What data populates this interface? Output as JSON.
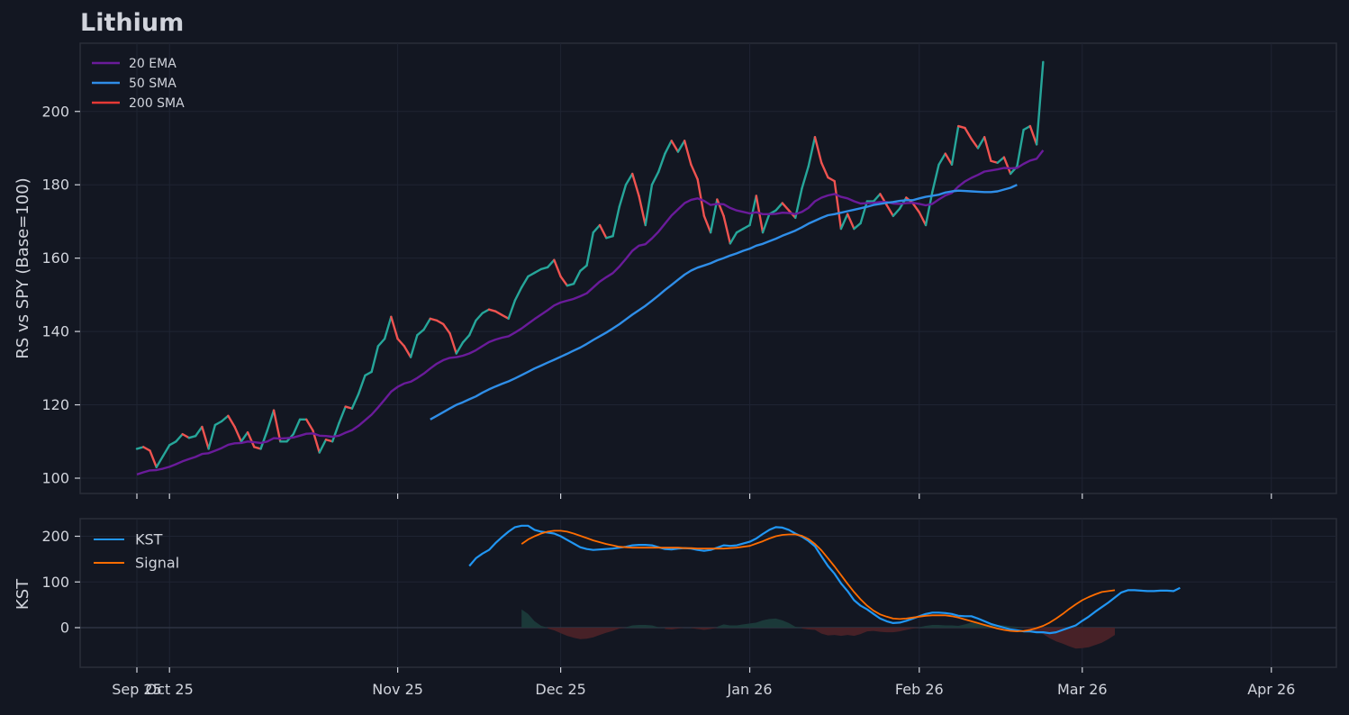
{
  "title": "Lithium",
  "colors": {
    "background": "#131722",
    "grid": "#1f2433",
    "axis_text": "#d1d4dc",
    "rs_up": "#26a69a",
    "rs_down": "#ef5350",
    "ema20": "#6a1b9a",
    "sma50": "#2f8ee8",
    "sma200": "#e53935",
    "kst": "#2196f3",
    "signal": "#ff6d00",
    "hist_pos": "#1b3b3b",
    "hist_neg": "#4a2228"
  },
  "chart_data": [
    {
      "type": "line",
      "panel": "rs",
      "ylabel": "RS vs SPY (Base=100)",
      "ylim": [
        96,
        218
      ],
      "yticks": [
        100,
        120,
        140,
        160,
        180,
        200
      ],
      "grid": true,
      "legend_placement": "top-left",
      "legend": [
        "20 EMA",
        "50 SMA",
        "200 SMA"
      ],
      "series": [
        {
          "name": "RS",
          "values": [
            108,
            108.5,
            107.5,
            103,
            106,
            109,
            110,
            112,
            111,
            111.5,
            114,
            108,
            114.5,
            115.5,
            117,
            114,
            110,
            112.5,
            108.5,
            108,
            113,
            118.5,
            110,
            110,
            112,
            116,
            116,
            113,
            107,
            110.5,
            110,
            115,
            119.5,
            119,
            123,
            128,
            129,
            136,
            138,
            144,
            138,
            136,
            133,
            139,
            140.5,
            143.5,
            143,
            142,
            139.5,
            134,
            137,
            139,
            143,
            145,
            146,
            145.5,
            144.5,
            143.5,
            148.5,
            152,
            155,
            156,
            157,
            157.5,
            159.5,
            155,
            152.5,
            153,
            156.5,
            158,
            167,
            169,
            165.5,
            166,
            174,
            180,
            183,
            177,
            169,
            180,
            183.5,
            188.5,
            192,
            189,
            192,
            185.5,
            181.5,
            171.5,
            167,
            176,
            171.5,
            164,
            167,
            168,
            169,
            177,
            167,
            172,
            173,
            175,
            173,
            171,
            179,
            185,
            193,
            186,
            182,
            181,
            168,
            172,
            168,
            169.5,
            175.5,
            175.5,
            177.5,
            174.5,
            171.5,
            173.5,
            176.5,
            175,
            172.5,
            169,
            178,
            185.5,
            188.5,
            185.5,
            196,
            195.5,
            192.5,
            190,
            193,
            186.5,
            186,
            187.5,
            183,
            185,
            195,
            196,
            191,
            213.5
          ]
        },
        {
          "name": "20 EMA",
          "values": [
            101,
            101.6,
            102.1,
            102.2,
            102.6,
            103.1,
            103.8,
            104.6,
            105.2,
            105.8,
            106.6,
            106.8,
            107.5,
            108.2,
            109.1,
            109.5,
            109.6,
            110,
            109.8,
            109.6,
            110,
            110.9,
            110.8,
            110.9,
            111.1,
            111.6,
            112.1,
            112.2,
            111.6,
            111.5,
            111.3,
            111.6,
            112.4,
            113.1,
            114.3,
            115.8,
            117.3,
            119.3,
            121.4,
            123.6,
            124.9,
            125.8,
            126.3,
            127.3,
            128.5,
            129.9,
            131.2,
            132.2,
            132.8,
            133,
            133.4,
            134,
            134.9,
            136,
            137.1,
            137.8,
            138.3,
            138.7,
            139.7,
            140.8,
            142.1,
            143.4,
            144.6,
            145.8,
            147.1,
            147.9,
            148.4,
            148.9,
            149.6,
            150.4,
            152,
            153.6,
            154.8,
            155.9,
            157.7,
            159.8,
            162,
            163.4,
            163.8,
            165.4,
            167.2,
            169.4,
            171.6,
            173.3,
            175,
            175.9,
            176.3,
            175.6,
            174.5,
            174.8,
            174.7,
            173.7,
            173,
            172.6,
            172.2,
            172.5,
            172,
            172,
            172.1,
            172.4,
            172.3,
            172,
            172.6,
            173.7,
            175.5,
            176.5,
            177.1,
            177.5,
            176.7,
            176.3,
            175.5,
            174.9,
            175,
            175.1,
            175.3,
            175.3,
            174.9,
            174.8,
            175,
            175.1,
            174.8,
            174.4,
            174.8,
            176,
            177.1,
            177.8,
            179.5,
            180.9,
            181.9,
            182.7,
            183.6,
            183.9,
            184.2,
            184.6,
            184.5,
            184.6,
            185.7,
            186.6,
            187.1,
            189.4
          ]
        },
        {
          "name": "50 SMA",
          "values": [
            null,
            null,
            null,
            null,
            null,
            null,
            null,
            null,
            null,
            null,
            null,
            null,
            null,
            null,
            null,
            null,
            null,
            null,
            null,
            null,
            null,
            null,
            null,
            null,
            null,
            null,
            null,
            null,
            null,
            null,
            null,
            null,
            null,
            null,
            null,
            null,
            null,
            null,
            null,
            null,
            null,
            null,
            null,
            null,
            null,
            116,
            117,
            118,
            119,
            120,
            120.7,
            121.5,
            122.3,
            123.3,
            124.2,
            125,
            125.7,
            126.4,
            127.2,
            128.1,
            129,
            129.9,
            130.7,
            131.5,
            132.3,
            133.1,
            133.9,
            134.8,
            135.6,
            136.6,
            137.7,
            138.7,
            139.7,
            140.8,
            142,
            143.3,
            144.6,
            145.8,
            147,
            148.4,
            149.8,
            151.3,
            152.7,
            154.1,
            155.5,
            156.6,
            157.4,
            158,
            158.6,
            159.4,
            160,
            160.7,
            161.3,
            162,
            162.6,
            163.4,
            163.9,
            164.6,
            165.3,
            166.1,
            166.8,
            167.5,
            168.4,
            169.4,
            170.2,
            171,
            171.7,
            172,
            172.4,
            172.8,
            173.2,
            173.6,
            174,
            174.5,
            174.8,
            175.1,
            175.3,
            175.6,
            175.8,
            175.8,
            176.3,
            176.7,
            177,
            177.3,
            177.9,
            178.2,
            178.4,
            178.3,
            178.2,
            178.1,
            178,
            178,
            178.2,
            178.7,
            179.2,
            180
          ]
        },
        {
          "name": "200 SMA",
          "values": []
        }
      ]
    },
    {
      "type": "line",
      "panel": "kst",
      "ylabel": "KST",
      "ylim": [
        -88,
        238
      ],
      "yticks": [
        0,
        100,
        200
      ],
      "grid": true,
      "legend_placement": "top-left",
      "legend": [
        "KST",
        "Signal"
      ],
      "xlabels": [
        "Sep 25",
        "Oct 25",
        "Nov 25",
        "Dec 25",
        "Jan 26",
        "Feb 26",
        "Mar 26",
        "Apr 26"
      ],
      "xlabel_positions": [
        0,
        5,
        40,
        65,
        94,
        120,
        145,
        174
      ],
      "series": [
        {
          "name": "KST",
          "values": [
            null,
            null,
            null,
            null,
            null,
            null,
            null,
            null,
            null,
            null,
            null,
            null,
            null,
            null,
            null,
            null,
            null,
            null,
            null,
            null,
            null,
            null,
            null,
            null,
            null,
            null,
            null,
            null,
            null,
            null,
            null,
            null,
            null,
            null,
            null,
            null,
            null,
            null,
            null,
            null,
            null,
            null,
            null,
            null,
            null,
            null,
            null,
            null,
            null,
            null,
            null,
            135,
            152,
            162,
            170,
            185,
            198,
            210,
            220,
            223,
            223,
            214,
            210,
            208,
            206,
            200,
            192,
            184,
            176,
            172,
            170,
            171,
            172,
            173,
            175,
            177,
            180,
            181,
            181,
            180,
            176,
            172,
            171,
            173,
            174,
            173,
            170,
            168,
            170,
            175,
            180,
            179,
            180,
            184,
            188,
            195,
            205,
            214,
            220,
            219,
            214,
            206,
            199,
            190,
            178,
            156,
            135,
            118,
            97,
            80,
            60,
            48,
            40,
            30,
            20,
            14,
            10,
            11,
            15,
            20,
            25,
            30,
            33,
            33,
            32,
            30,
            26,
            25,
            25,
            20,
            14,
            8,
            4,
            0,
            -4,
            -6,
            -8,
            -8,
            -10,
            -10,
            -12,
            -10,
            -5,
            0,
            5,
            15,
            24,
            35,
            45,
            55,
            66,
            77,
            82,
            82,
            81,
            80,
            80,
            81,
            81,
            80,
            87
          ]
        },
        {
          "name": "Signal",
          "values": [
            null,
            null,
            null,
            null,
            null,
            null,
            null,
            null,
            null,
            null,
            null,
            null,
            null,
            null,
            null,
            null,
            null,
            null,
            null,
            null,
            null,
            null,
            null,
            null,
            null,
            null,
            null,
            null,
            null,
            null,
            null,
            null,
            null,
            null,
            null,
            null,
            null,
            null,
            null,
            null,
            null,
            null,
            null,
            null,
            null,
            null,
            null,
            null,
            null,
            null,
            null,
            null,
            null,
            null,
            null,
            null,
            null,
            null,
            null,
            183,
            193,
            200,
            206,
            210,
            212,
            212,
            210,
            206,
            201,
            196,
            191,
            187,
            183,
            180,
            177,
            176,
            175,
            175,
            175,
            175,
            175,
            175,
            175,
            175,
            174,
            174,
            173,
            173,
            173,
            173,
            173,
            174,
            175,
            177,
            179,
            184,
            189,
            195,
            200,
            203,
            204,
            204,
            201,
            194,
            183,
            169,
            152,
            134,
            115,
            96,
            78,
            62,
            48,
            37,
            29,
            24,
            20,
            19,
            20,
            22,
            24,
            26,
            27,
            27,
            27,
            25,
            22,
            18,
            14,
            10,
            6,
            2,
            -2,
            -5,
            -7,
            -8,
            -7,
            -5,
            -1,
            4,
            11,
            20,
            30,
            41,
            51,
            60,
            67,
            73,
            78,
            80,
            82
          ]
        }
      ]
    }
  ]
}
